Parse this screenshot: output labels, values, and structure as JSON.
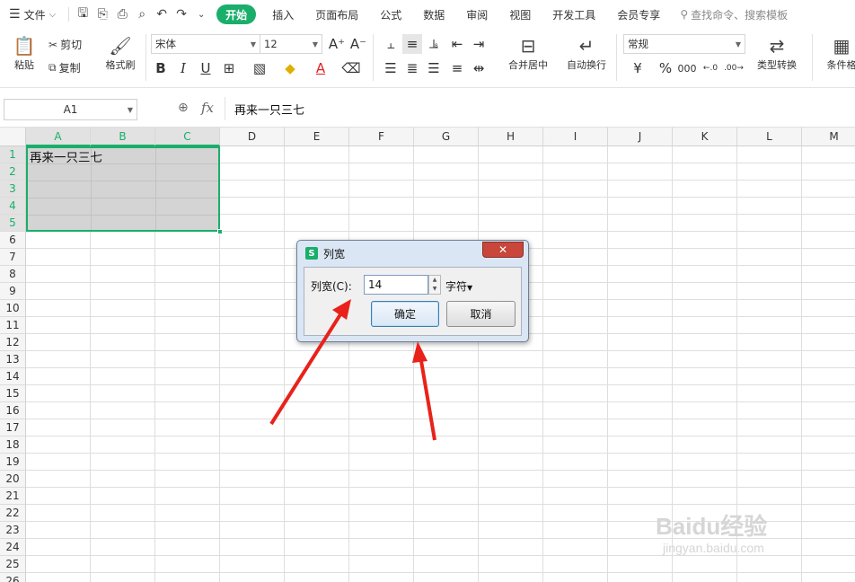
{
  "menubar": {
    "file_label": "文件",
    "tabs": [
      "开始",
      "插入",
      "页面布局",
      "公式",
      "数据",
      "审阅",
      "视图",
      "开发工具",
      "会员专享"
    ],
    "active_tab": "开始",
    "search_label": "查找命令、搜索模板"
  },
  "toolbar": {
    "paste": "粘贴",
    "cut": "剪切",
    "copy": "复制",
    "format_painter": "格式刷",
    "font_name": "宋体",
    "font_size": "12",
    "merge_center": "合并居中",
    "wrap_text": "自动换行",
    "number_format": "常规",
    "type_convert": "类型转换",
    "conditional": "条件格"
  },
  "formula_bar": {
    "name_box": "A1",
    "fx_label": "fx",
    "content": "再来一只三七"
  },
  "sheet": {
    "columns": [
      "A",
      "B",
      "C",
      "D",
      "E",
      "F",
      "G",
      "H",
      "I",
      "J",
      "K",
      "L",
      "M"
    ],
    "rows": [
      "1",
      "2",
      "3",
      "4",
      "5",
      "6",
      "7",
      "8",
      "9",
      "10",
      "11",
      "12",
      "13",
      "14",
      "15",
      "16",
      "17",
      "18",
      "19",
      "20",
      "21",
      "22",
      "23",
      "24",
      "25",
      "26"
    ],
    "cell_a1": "再来一只三七"
  },
  "dialog": {
    "title": "列宽",
    "close": "✕",
    "field_label": "列宽(C):",
    "field_value": "14",
    "unit": "字符",
    "ok": "确定",
    "cancel": "取消"
  },
  "watermark": {
    "brand": "Baidu经验",
    "url": "jingyan.baidu.com"
  }
}
